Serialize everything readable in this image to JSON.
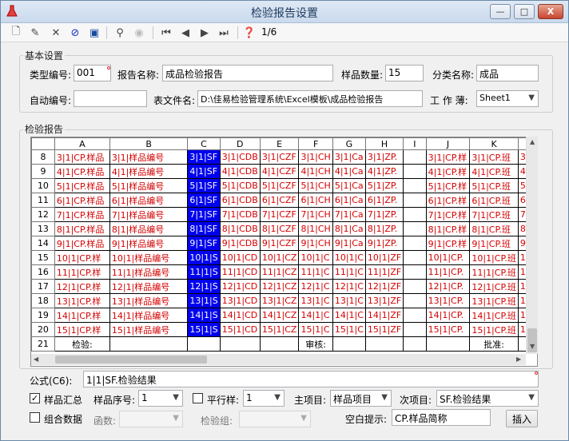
{
  "window": {
    "title": "检验报告设置",
    "min": "—",
    "max": "□",
    "close": "X",
    "accent": "#c9d9ec"
  },
  "toolbar": {
    "page_count": "1/6",
    "icons": [
      "new-icon",
      "edit-icon",
      "delete-icon",
      "cancel-icon",
      "save-icon",
      "find-icon",
      "disabled-icon",
      "first-icon",
      "prev-icon",
      "next-icon",
      "last-icon",
      "help-icon"
    ]
  },
  "basic": {
    "group_label": "基本设置",
    "type_code_label": "类型编号:",
    "type_code": "001",
    "report_name_label": "报告名称:",
    "report_name": "成品检验报告",
    "sample_qty_label": "样品数量:",
    "sample_qty": "15",
    "category_label": "分类名称:",
    "category": "成品",
    "auto_code_label": "自动编号:",
    "auto_code": "",
    "table_file_label": "表文件名:",
    "table_file": "D:\\佳易检验管理系统\\Excel模板\\成品检验报告",
    "workbook_label": "工 作 薄:",
    "workbook": "Sheet1"
  },
  "report": {
    "group_label": "检验报告",
    "columns": [
      "",
      "A",
      "B",
      "C",
      "D",
      "E",
      "F",
      "G",
      "H",
      "I",
      "J",
      "K",
      ""
    ],
    "rows": [
      {
        "n": "8",
        "c": [
          "3|1|CP.样品",
          "3|1|样品编号",
          "3|1|SF",
          "3|1|CDB",
          "3|1|CZF",
          "3|1|CH",
          "3|1|Ca",
          "3|1|ZP.",
          "",
          "3|1|CP.样",
          "3|1|CP.班",
          "3|"
        ]
      },
      {
        "n": "9",
        "c": [
          "4|1|CP.样品",
          "4|1|样品编号",
          "4|1|SF",
          "4|1|CDB",
          "4|1|CZF",
          "4|1|CH",
          "4|1|Ca",
          "4|1|ZP.",
          "",
          "4|1|CP.样",
          "4|1|CP.班",
          "4|"
        ]
      },
      {
        "n": "10",
        "c": [
          "5|1|CP.样品",
          "5|1|样品编号",
          "5|1|SF",
          "5|1|CDB",
          "5|1|CZF",
          "5|1|CH",
          "5|1|Ca",
          "5|1|ZP.",
          "",
          "5|1|CP.样",
          "5|1|CP.班",
          "5|"
        ]
      },
      {
        "n": "11",
        "c": [
          "6|1|CP.样品",
          "6|1|样品编号",
          "6|1|SF",
          "6|1|CDB",
          "6|1|CZF",
          "6|1|CH",
          "6|1|Ca",
          "6|1|ZP.",
          "",
          "6|1|CP.样",
          "6|1|CP.班",
          "6|"
        ]
      },
      {
        "n": "12",
        "c": [
          "7|1|CP.样品",
          "7|1|样品编号",
          "7|1|SF",
          "7|1|CDB",
          "7|1|CZF",
          "7|1|CH",
          "7|1|Ca",
          "7|1|ZP.",
          "",
          "7|1|CP.样",
          "7|1|CP.班",
          "7|"
        ]
      },
      {
        "n": "13",
        "c": [
          "8|1|CP.样品",
          "8|1|样品编号",
          "8|1|SF",
          "8|1|CDB",
          "8|1|CZF",
          "8|1|CH",
          "8|1|Ca",
          "8|1|ZP.",
          "",
          "8|1|CP.样",
          "8|1|CP.班",
          "8|"
        ]
      },
      {
        "n": "14",
        "c": [
          "9|1|CP.样品",
          "9|1|样品编号",
          "9|1|SF",
          "9|1|CDB",
          "9|1|CZF",
          "9|1|CH",
          "9|1|Ca",
          "9|1|ZP.",
          "",
          "9|1|CP.样",
          "9|1|CP.班",
          "9|"
        ]
      },
      {
        "n": "15",
        "c": [
          "10|1|CP.样",
          "10|1|样品编号",
          "10|1|S",
          "10|1|CD",
          "10|1|CZ",
          "10|1|C",
          "10|1|C",
          "10|1|ZF",
          "",
          "10|1|CP.",
          "10|1|CP.班",
          "10"
        ]
      },
      {
        "n": "16",
        "c": [
          "11|1|CP.样",
          "11|1|样品编号",
          "11|1|S",
          "11|1|CD",
          "11|1|CZ",
          "11|1|C",
          "11|1|C",
          "11|1|ZF",
          "",
          "11|1|CP.",
          "11|1|CP.班",
          "11"
        ]
      },
      {
        "n": "17",
        "c": [
          "12|1|CP.样",
          "12|1|样品编号",
          "12|1|S",
          "12|1|CD",
          "12|1|CZ",
          "12|1|C",
          "12|1|C",
          "12|1|ZF",
          "",
          "12|1|CP.",
          "12|1|CP.班",
          "12"
        ]
      },
      {
        "n": "18",
        "c": [
          "13|1|CP.样",
          "13|1|样品编号",
          "13|1|S",
          "13|1|CD",
          "13|1|CZ",
          "13|1|C",
          "13|1|C",
          "13|1|ZF",
          "",
          "13|1|CP.",
          "13|1|CP.班",
          "13"
        ]
      },
      {
        "n": "19",
        "c": [
          "14|1|CP.样",
          "14|1|样品编号",
          "14|1|S",
          "14|1|CD",
          "14|1|CZ",
          "14|1|C",
          "14|1|C",
          "14|1|ZF",
          "",
          "14|1|CP.",
          "14|1|CP.班",
          "14"
        ]
      },
      {
        "n": "20",
        "c": [
          "15|1|CP.样",
          "15|1|样品编号",
          "15|1|S",
          "15|1|CD",
          "15|1|CZ",
          "15|1|C",
          "15|1|C",
          "15|1|ZF",
          "",
          "15|1|CP.",
          "15|1|CP.班",
          "15"
        ]
      }
    ],
    "last_row": {
      "n": "21",
      "inspect": "检验:",
      "audit": "审核:",
      "approve": "批准:"
    }
  },
  "formula": {
    "label": "公式(C6):",
    "value": "1|1|SF.检验结果"
  },
  "bottom": {
    "summary_checked": true,
    "summary_label": "样品汇总",
    "seq_label": "样品序号:",
    "seq": "1",
    "parallel_checked": false,
    "parallel_label": "平行样:",
    "parallel": "1",
    "main_item_label": "主项目:",
    "main_item": "样品项目",
    "sub_item_label": "次项目:",
    "sub_item": "SF.检验结果",
    "combine_checked": false,
    "combine_label": "组合数据",
    "func_label": "函数:",
    "func": "",
    "group_label": "检验组:",
    "group": "",
    "blank_hint_label": "空白提示:",
    "blank_hint": "CP.样品简称",
    "insert_label": "插入"
  }
}
